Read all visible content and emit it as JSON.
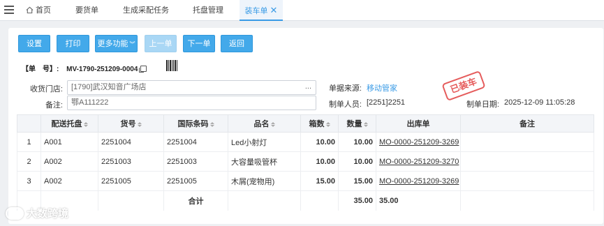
{
  "tabs": {
    "home": "首页",
    "items": [
      "要货单",
      "生成采配任务",
      "托盘管理"
    ],
    "active": "装车单"
  },
  "toolbar": {
    "settings": "设置",
    "print": "打印",
    "more": "更多功能",
    "prev": "上一单",
    "next": "下一单",
    "back": "返回"
  },
  "doc": {
    "number_label": "【单　号】:",
    "number": "MV-1790-251209-0004"
  },
  "form": {
    "store_label": "收货门店:",
    "store_value": "[1790]武汉知音广场店",
    "store_picker": "...",
    "remark_label": "备注:",
    "remark_value": "鄂A111222",
    "source_label": "单据来源:",
    "source_value": "移动管家",
    "creator_label": "制单人员:",
    "creator_value": "[2251]2251",
    "date_label": "制单日期:",
    "date_value": "2025-12-09 11:05:28",
    "stamp": "已装车"
  },
  "table": {
    "headers": [
      "",
      "配送托盘",
      "货号",
      "国际条码",
      "品名",
      "箱数",
      "数量",
      "出库单",
      "备注"
    ],
    "rows": [
      {
        "no": "1",
        "pallet": "A001",
        "sku": "2251004",
        "barcode": "2251004",
        "name": "Led小射灯",
        "boxes": "10.00",
        "qty": "10.00",
        "outbound": "MO-0000-251209-3269",
        "remark": ""
      },
      {
        "no": "2",
        "pallet": "A002",
        "sku": "2251003",
        "barcode": "2251003",
        "name": "大容量吸管杯",
        "boxes": "10.00",
        "qty": "10.00",
        "outbound": "MO-0000-251209-3270",
        "remark": ""
      },
      {
        "no": "3",
        "pallet": "A002",
        "sku": "2251005",
        "barcode": "2251005",
        "name": "木屑(宠物用)",
        "boxes": "15.00",
        "qty": "15.00",
        "outbound": "MO-0000-251209-3269",
        "remark": ""
      }
    ],
    "total_label": "合计",
    "total_boxes": "35.00",
    "total_qty": "35.00"
  },
  "watermark": "大数跨境",
  "colors": {
    "accent": "#43a9ea",
    "stamp": "#e34a4a",
    "link": "#3a9be6"
  }
}
